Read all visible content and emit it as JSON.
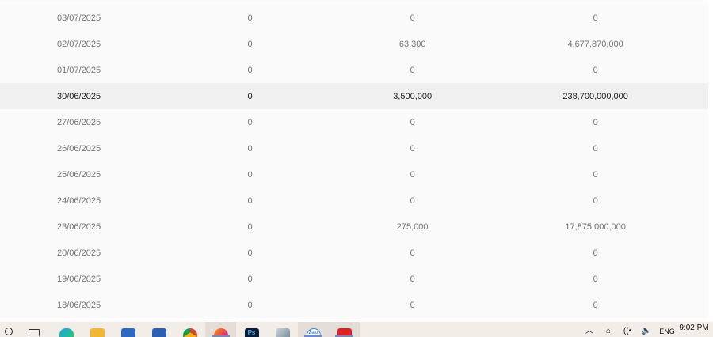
{
  "table": {
    "rows": [
      {
        "date": "03/07/2025",
        "col_a": "0",
        "col_b": "0",
        "col_c": "0",
        "highlighted": false
      },
      {
        "date": "02/07/2025",
        "col_a": "0",
        "col_b": "63,300",
        "col_c": "4,677,870,000",
        "highlighted": false
      },
      {
        "date": "01/07/2025",
        "col_a": "0",
        "col_b": "0",
        "col_c": "0",
        "highlighted": false
      },
      {
        "date": "30/06/2025",
        "col_a": "0",
        "col_b": "3,500,000",
        "col_c": "238,700,000,000",
        "highlighted": true
      },
      {
        "date": "27/06/2025",
        "col_a": "0",
        "col_b": "0",
        "col_c": "0",
        "highlighted": false
      },
      {
        "date": "26/06/2025",
        "col_a": "0",
        "col_b": "0",
        "col_c": "0",
        "highlighted": false
      },
      {
        "date": "25/06/2025",
        "col_a": "0",
        "col_b": "0",
        "col_c": "0",
        "highlighted": false
      },
      {
        "date": "24/06/2025",
        "col_a": "0",
        "col_b": "0",
        "col_c": "0",
        "highlighted": false
      },
      {
        "date": "23/06/2025",
        "col_a": "0",
        "col_b": "275,000",
        "col_c": "17,875,000,000",
        "highlighted": false
      },
      {
        "date": "20/06/2025",
        "col_a": "0",
        "col_b": "0",
        "col_c": "0",
        "highlighted": false
      },
      {
        "date": "19/06/2025",
        "col_a": "0",
        "col_b": "0",
        "col_c": "0",
        "highlighted": false
      },
      {
        "date": "18/06/2025",
        "col_a": "0",
        "col_b": "0",
        "col_c": "0",
        "highlighted": false
      }
    ]
  },
  "taskbar": {
    "apps": [
      {
        "name": "search-icon",
        "active": false
      },
      {
        "name": "task-view-icon",
        "active": false
      },
      {
        "name": "edge-icon",
        "active": false
      },
      {
        "name": "file-explorer-icon",
        "active": false
      },
      {
        "name": "store-icon",
        "active": false
      },
      {
        "name": "word-icon",
        "active": false
      },
      {
        "name": "chrome-icon",
        "active": false
      },
      {
        "name": "firefox-icon",
        "active": true
      },
      {
        "name": "photoshop-icon",
        "active": false
      },
      {
        "name": "files-icon",
        "active": false
      },
      {
        "name": "zalo-icon",
        "active": true
      },
      {
        "name": "red-app-icon",
        "active": true
      }
    ],
    "ps_label": "Ps",
    "zalo_label": "Zalo",
    "tray": {
      "chevron": "︿",
      "network": "⌂",
      "wifi": "((•",
      "volume": "🔈",
      "lang": "ENG"
    },
    "clock": "9:02 PM"
  }
}
